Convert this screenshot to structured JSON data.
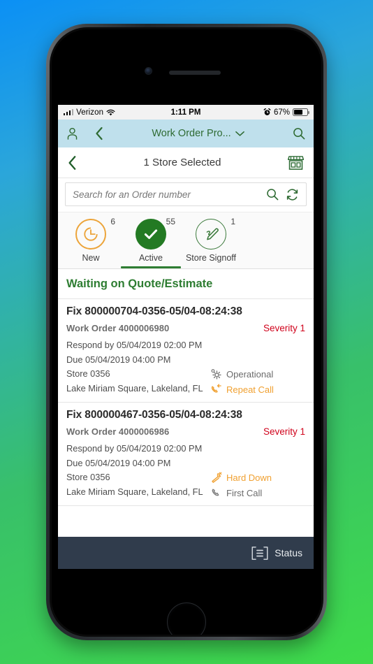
{
  "device": {
    "frame": "iphone-8",
    "home_button": "home-button"
  },
  "background": {
    "gradient_from": "#0b90f5",
    "gradient_to": "#3fdb4a"
  },
  "ios_status_bar": {
    "carrier": "Verizon",
    "wifi_icon": "wifi-icon",
    "signal_icon": "signal-bars-icon",
    "time": "1:11 PM",
    "alarm_icon": "alarm-clock-icon",
    "battery_percent": "67%",
    "battery_icon": "battery-icon"
  },
  "navbar": {
    "profile_icon": "person-icon",
    "back_icon": "chevron-left-icon",
    "title": "Work Order Pro...",
    "dropdown_icon": "chevron-down-icon",
    "search_icon": "search-icon",
    "accent_color": "#2f6b33",
    "background_color": "#bfe0ec"
  },
  "storebar": {
    "back_icon": "chevron-left-icon",
    "title": "1 Store Selected",
    "store_icon": "storefront-icon"
  },
  "search": {
    "value": "",
    "placeholder": "Search for an Order number",
    "search_icon": "search-icon",
    "refresh_icon": "refresh-icon"
  },
  "tabs": [
    {
      "label": "New",
      "count": "6",
      "icon": "clock-icon",
      "style": "outline-orange",
      "selected": false,
      "color": "#eca43a"
    },
    {
      "label": "Active",
      "count": "55",
      "icon": "check-icon",
      "style": "fill-green",
      "selected": true,
      "color": "#237a23"
    },
    {
      "label": "Store Signoff",
      "count": "1",
      "icon": "pencil-icon",
      "style": "outline-green",
      "selected": false,
      "color": "#3c7a3c"
    }
  ],
  "section": {
    "title": "Waiting on Quote/Estimate"
  },
  "orders": [
    {
      "fix": "Fix 800000704-0356-05/04-08:24:38",
      "work_order": "Work Order 4000006980",
      "severity": "Severity 1",
      "respond_by": "Respond by 05/04/2019 02:00 PM",
      "due": "Due 05/04/2019 04:00 PM",
      "store": "Store 0356",
      "location": "Lake Miriam Square, Lakeland, FL",
      "flags": [
        {
          "label": "Operational",
          "icon": "gear-icon",
          "tone": "gray"
        },
        {
          "label": "Repeat Call",
          "icon": "repeat-call-icon",
          "tone": "orange"
        }
      ]
    },
    {
      "fix": "Fix 800000467-0356-05/04-08:24:38",
      "work_order": "Work Order 4000006986",
      "severity": "Severity 1",
      "respond_by": "Respond by 05/04/2019 02:00 PM",
      "due": "Due 05/04/2019 04:00 PM",
      "store": "Store 0356",
      "location": "Lake Miriam Square, Lakeland, FL",
      "flags": [
        {
          "label": "Hard Down",
          "icon": "wrench-x-icon",
          "tone": "orange"
        },
        {
          "label": "First Call",
          "icon": "phone-icon",
          "tone": "gray"
        }
      ]
    }
  ],
  "bottom_bar": {
    "status_label": "Status",
    "status_icon": "bracketed-list-icon",
    "background_color": "#303c4c"
  }
}
